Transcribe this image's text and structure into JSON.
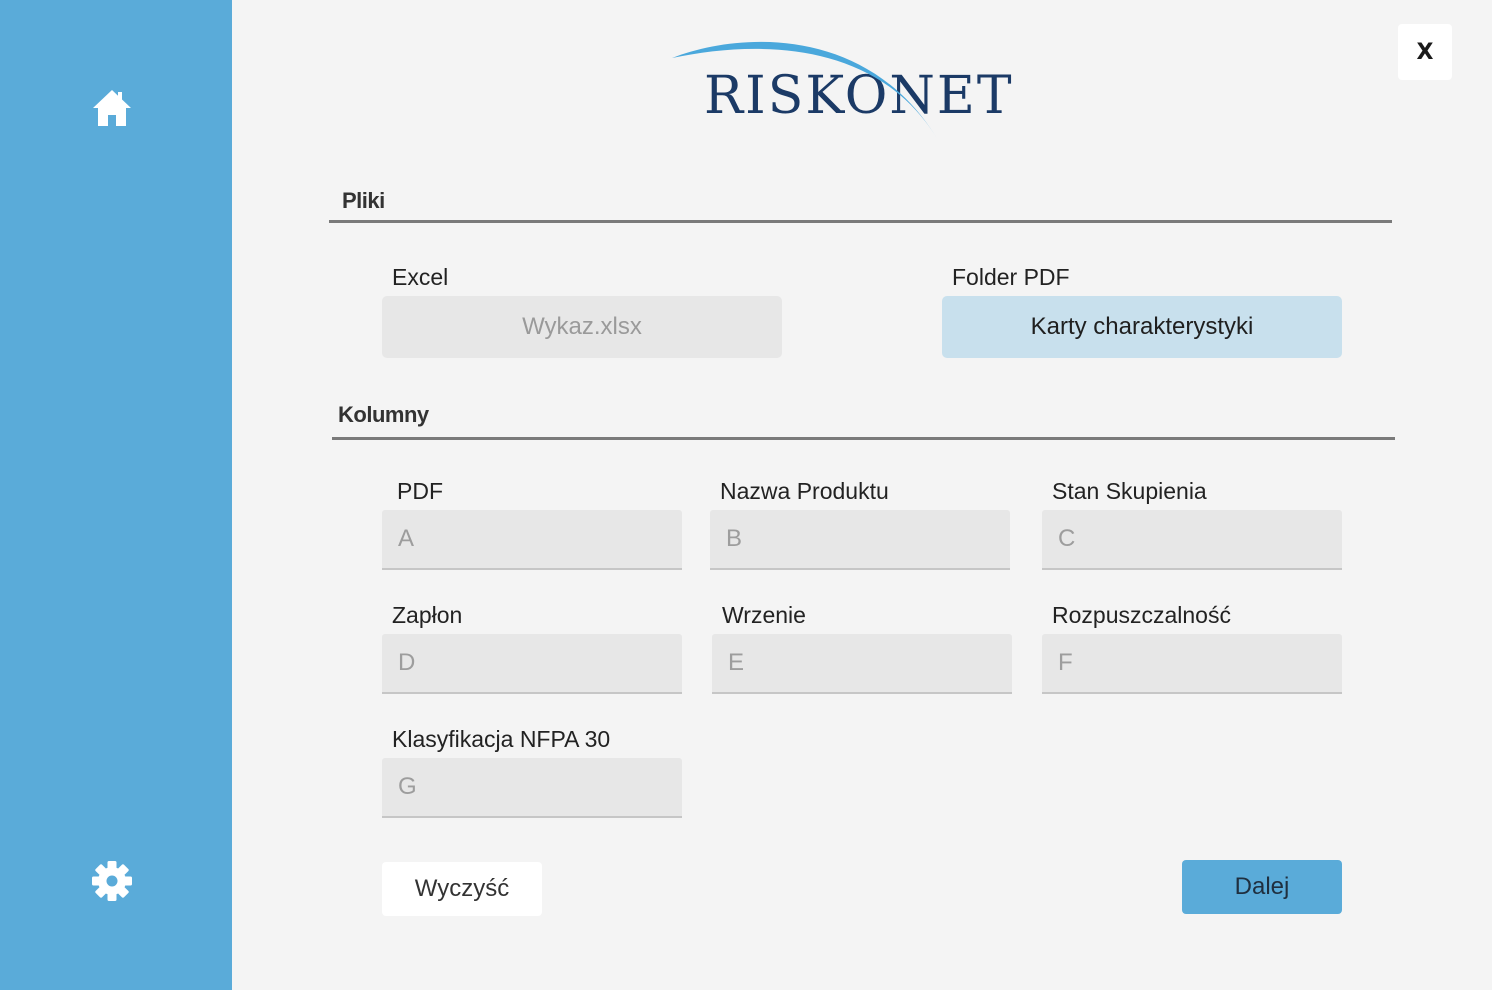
{
  "app": {
    "logo_text": "RISKONET",
    "close_label": "X"
  },
  "sidebar": {
    "items": [
      {
        "icon": "home-icon"
      },
      {
        "icon": "gear-icon"
      }
    ]
  },
  "files": {
    "section_title": "Pliki",
    "excel": {
      "label": "Excel",
      "value": "Wykaz.xlsx"
    },
    "pdf_folder": {
      "label": "Folder PDF",
      "value": "Karty charakterystyki"
    }
  },
  "columns": {
    "section_title": "Kolumny",
    "fields": [
      {
        "label": "PDF",
        "placeholder": "A"
      },
      {
        "label": "Nazwa Produktu",
        "placeholder": "B"
      },
      {
        "label": "Stan Skupienia",
        "placeholder": "C"
      },
      {
        "label": "Zapłon",
        "placeholder": "D"
      },
      {
        "label": "Wrzenie",
        "placeholder": "E"
      },
      {
        "label": "Rozpuszczalność",
        "placeholder": "F"
      },
      {
        "label": "Klasyfikacja NFPA 30",
        "placeholder": "G"
      }
    ]
  },
  "actions": {
    "clear_label": "Wyczyść",
    "next_label": "Dalej"
  },
  "colors": {
    "sidebar": "#5aabd9",
    "accent": "#5aabd9",
    "logo": "#1b3a66",
    "pdf_button": "#c8e0ed"
  }
}
